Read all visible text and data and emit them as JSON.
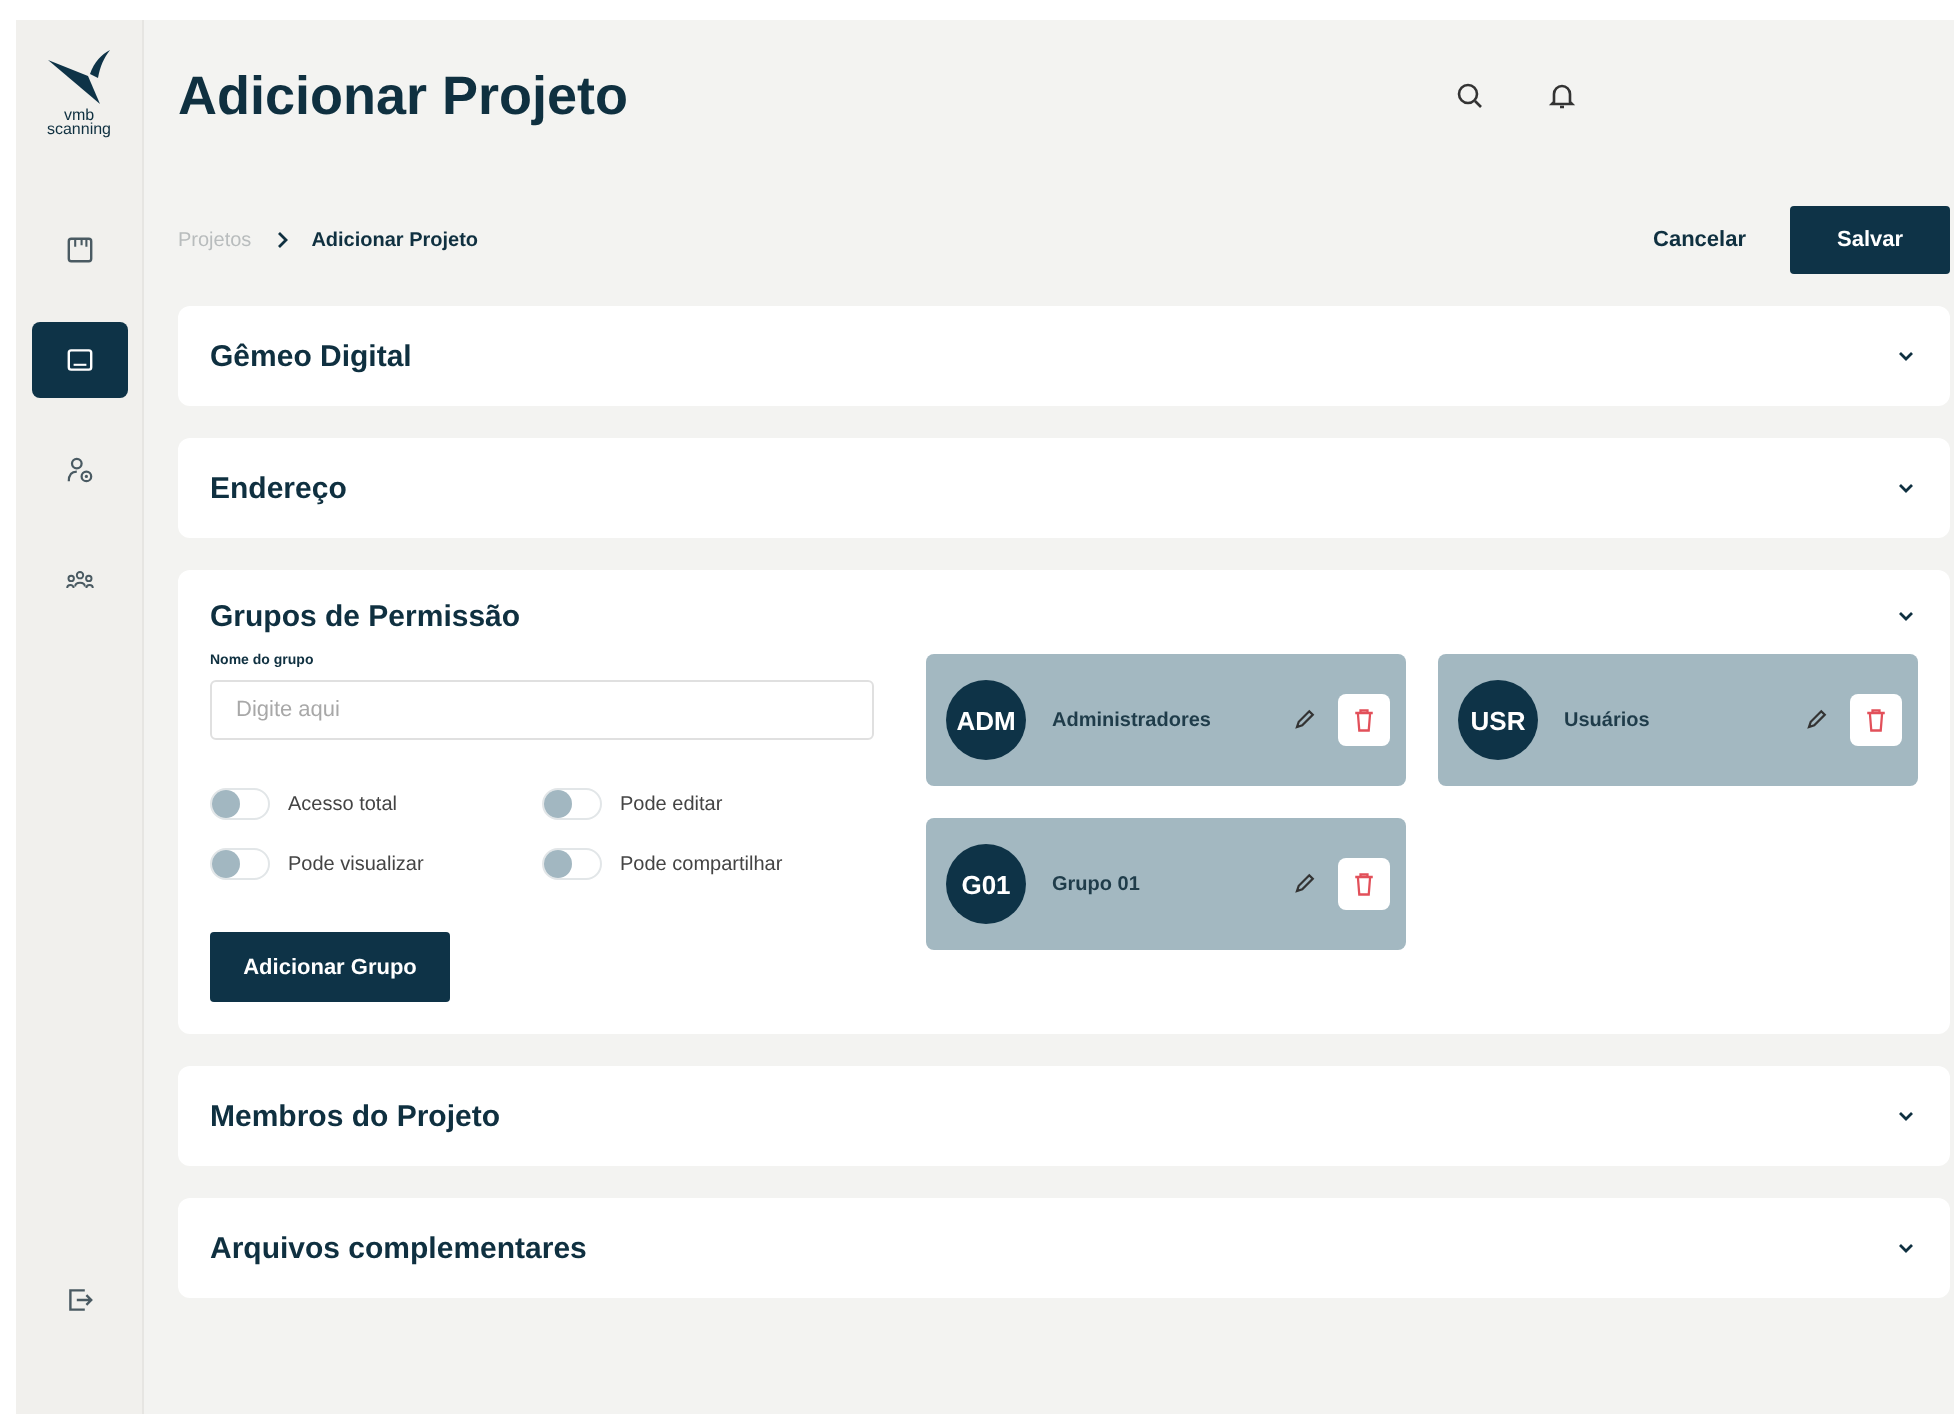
{
  "logo": {
    "line_1": "vmb",
    "line_2": "scanning"
  },
  "sidebar": {
    "items": [
      {
        "selected": false
      },
      {
        "selected": true
      },
      {
        "selected": false
      },
      {
        "selected": false
      }
    ]
  },
  "header": {
    "title": "Adicionar Projeto"
  },
  "breadcrumb": [
    "Projetos",
    "Adicionar Projeto"
  ],
  "actions": {
    "cancel": "Cancelar",
    "save": "Salvar"
  },
  "sections": [
    {
      "title": "Gêmeo Digital",
      "expanded": false
    },
    {
      "title": "Endereço",
      "expanded": false
    },
    {
      "title": "Grupos de Permissão",
      "expanded": true
    },
    {
      "title": "Membros do Projeto",
      "expanded": false
    },
    {
      "title": "Arquivos complementares",
      "expanded": false
    }
  ],
  "group_form": {
    "label": "Nome do grupo",
    "placeholder": "Digite aqui",
    "toggles": [
      {
        "label": "Acesso total",
        "on": false
      },
      {
        "label": "Pode editar",
        "on": false
      },
      {
        "label": "Pode visualizar",
        "on": false
      },
      {
        "label": "Pode compartilhar",
        "on": false
      }
    ],
    "button": "Adicionar Grupo"
  },
  "groups": [
    {
      "initials": "ADM",
      "name": "Administradores"
    },
    {
      "initials": "USR",
      "name": "Usuários"
    },
    {
      "initials": "G01",
      "name": "Grupo 01"
    }
  ]
}
